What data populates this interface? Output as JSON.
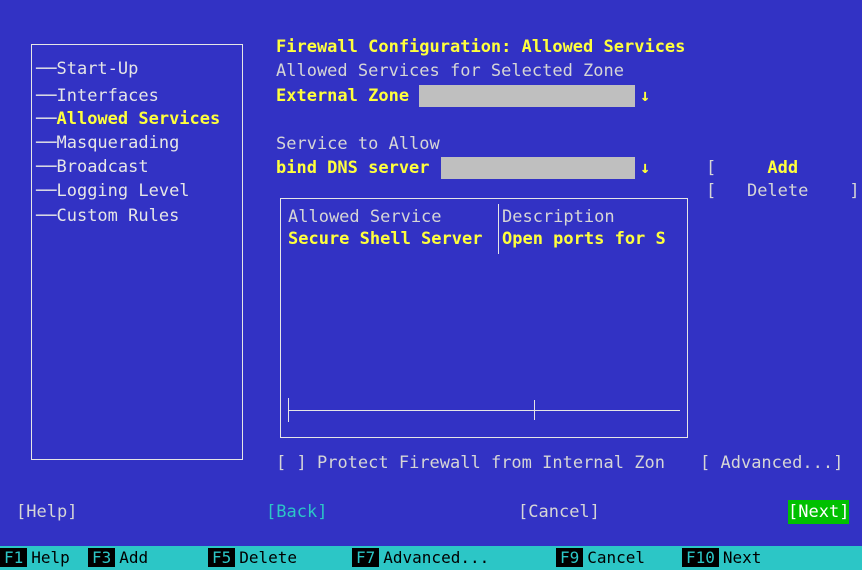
{
  "nav": {
    "items": [
      {
        "label": "Start-Up",
        "active": false
      },
      {
        "label": "Interfaces",
        "active": false
      },
      {
        "label": "Allowed Services",
        "active": true
      },
      {
        "label": "Masquerading",
        "active": false
      },
      {
        "label": "Broadcast",
        "active": false
      },
      {
        "label": "Logging Level",
        "active": false
      },
      {
        "label": "Custom Rules",
        "active": false
      }
    ]
  },
  "page": {
    "title": "Firewall Configuration: Allowed Services",
    "subtitle": "Allowed Services for Selected Zone"
  },
  "zone": {
    "value": "External Zone"
  },
  "service": {
    "label": "Service to Allow",
    "value": "bind DNS server"
  },
  "actions": {
    "add": "Add",
    "delete": "Delete",
    "advanced": "Advanced..."
  },
  "table": {
    "columns": [
      "Allowed Service",
      "Description"
    ],
    "rows": [
      {
        "service": "Secure Shell Server",
        "description": "Open ports for S"
      }
    ]
  },
  "protect": {
    "checkbox": "[ ]",
    "label": "Protect Firewall from Internal Zon"
  },
  "buttons": {
    "help": "Help",
    "back": "Back",
    "cancel": "Cancel",
    "next": "Next"
  },
  "fkeys": [
    {
      "key": "F1",
      "label": "Help"
    },
    {
      "key": "F3",
      "label": "Add"
    },
    {
      "key": "F5",
      "label": "Delete"
    },
    {
      "key": "F7",
      "label": "Advanced..."
    },
    {
      "key": "F9",
      "label": "Cancel"
    },
    {
      "key": "F10",
      "label": "Next"
    }
  ],
  "colors": {
    "background": "#3232c4",
    "highlight": "#ffff3c",
    "field": "#bfbfbf",
    "fkey_bar": "#2cc6c6",
    "next_button": "#00c000"
  }
}
